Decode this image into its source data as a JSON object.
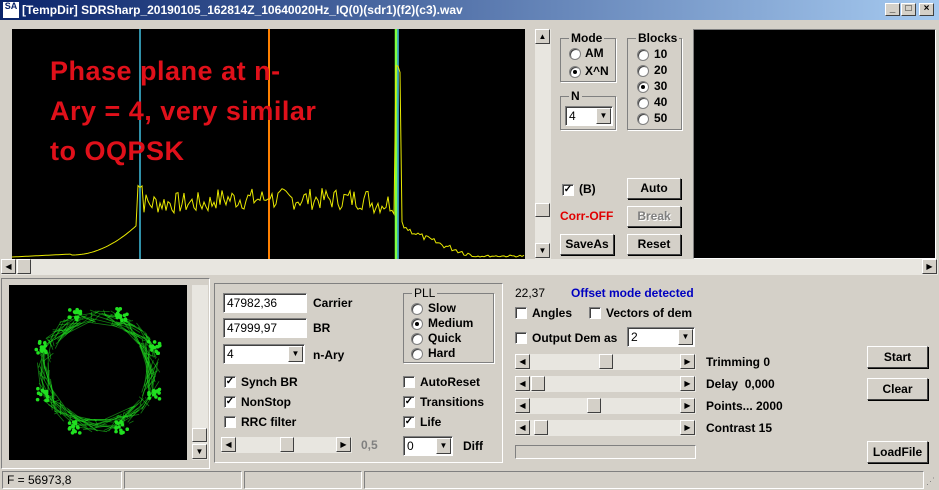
{
  "window": {
    "icon_text": "SA",
    "title": "[TempDir] SDRSharp_20190105_162814Z_10640020Hz_IQ(0)(sdr1)(f2)(c3).wav",
    "minimize": "_",
    "maximize": "□",
    "close": "×"
  },
  "spectrum": {
    "annotation_lines": [
      "Phase plane at n-",
      "Ary = 4, very similar",
      "to OQPSK"
    ],
    "annotation_color": "#e0101a",
    "trace_color": "#e8e800",
    "marker_colors": [
      "#40c0e0",
      "#ff8000",
      "#80ff40",
      "#40c0e0"
    ]
  },
  "mode": {
    "title": "Mode",
    "options": [
      {
        "label": "AM",
        "selected": false
      },
      {
        "label": "X^N",
        "selected": true
      }
    ]
  },
  "n": {
    "title": "N",
    "value": "4"
  },
  "blocks": {
    "title": "Blocks",
    "options": [
      {
        "label": "10",
        "selected": false
      },
      {
        "label": "20",
        "selected": false
      },
      {
        "label": "30",
        "selected": true
      },
      {
        "label": "40",
        "selected": false
      },
      {
        "label": "50",
        "selected": false
      }
    ]
  },
  "top_controls": {
    "b_check": {
      "label": "(B)",
      "checked": true
    },
    "corr_label": "Corr-OFF",
    "corr_color": "#e00000",
    "auto": "Auto",
    "break": "Break",
    "saveas": "SaveAs",
    "reset": "Reset"
  },
  "phase_plane": {
    "color": "#20e020"
  },
  "params": {
    "carrier_value": "47982,36",
    "carrier_label": "Carrier",
    "br_value": "47999,97",
    "br_label": "BR",
    "nary_value": "4",
    "nary_label": "n-Ary",
    "synch_br": {
      "label": "Synch BR",
      "checked": true
    },
    "nonstop": {
      "label": "NonStop",
      "checked": true
    },
    "rrc": {
      "label": "RRC filter",
      "checked": false
    },
    "rolloff_value": "0,5",
    "rolloff_fraction": 0.5
  },
  "pll": {
    "title": "PLL",
    "options": [
      {
        "label": "Slow",
        "selected": false
      },
      {
        "label": "Medium",
        "selected": true
      },
      {
        "label": "Quick",
        "selected": false
      },
      {
        "label": "Hard",
        "selected": false
      }
    ]
  },
  "pll_checks": {
    "autoreset": {
      "label": "AutoReset",
      "checked": false
    },
    "transitions": {
      "label": "Transitions",
      "checked": true
    },
    "life": {
      "label": "Life",
      "checked": true
    }
  },
  "diff": {
    "value": "0",
    "label": "Diff"
  },
  "analysis": {
    "value": "22,37",
    "offset_msg": "Offset mode detected",
    "offset_color": "#0000c0",
    "angles": {
      "label": "Angles",
      "checked": false
    },
    "vectors": {
      "label": "Vectors of dem",
      "checked": false
    },
    "output": {
      "label": "Output Dem as",
      "checked": false
    },
    "output_value": "2"
  },
  "sliders": [
    {
      "label": "Trimming 0",
      "fraction": 0.5
    },
    {
      "label": "Delay  0,000",
      "fraction": 0.0
    },
    {
      "label": "Points... 2000",
      "fraction": 0.41
    },
    {
      "label": "Contrast 15",
      "fraction": 0.02
    }
  ],
  "right_buttons": {
    "start": "Start",
    "clear": "Clear",
    "loadfile": "LoadFile"
  },
  "status": {
    "freq": "F = 56973,8"
  }
}
